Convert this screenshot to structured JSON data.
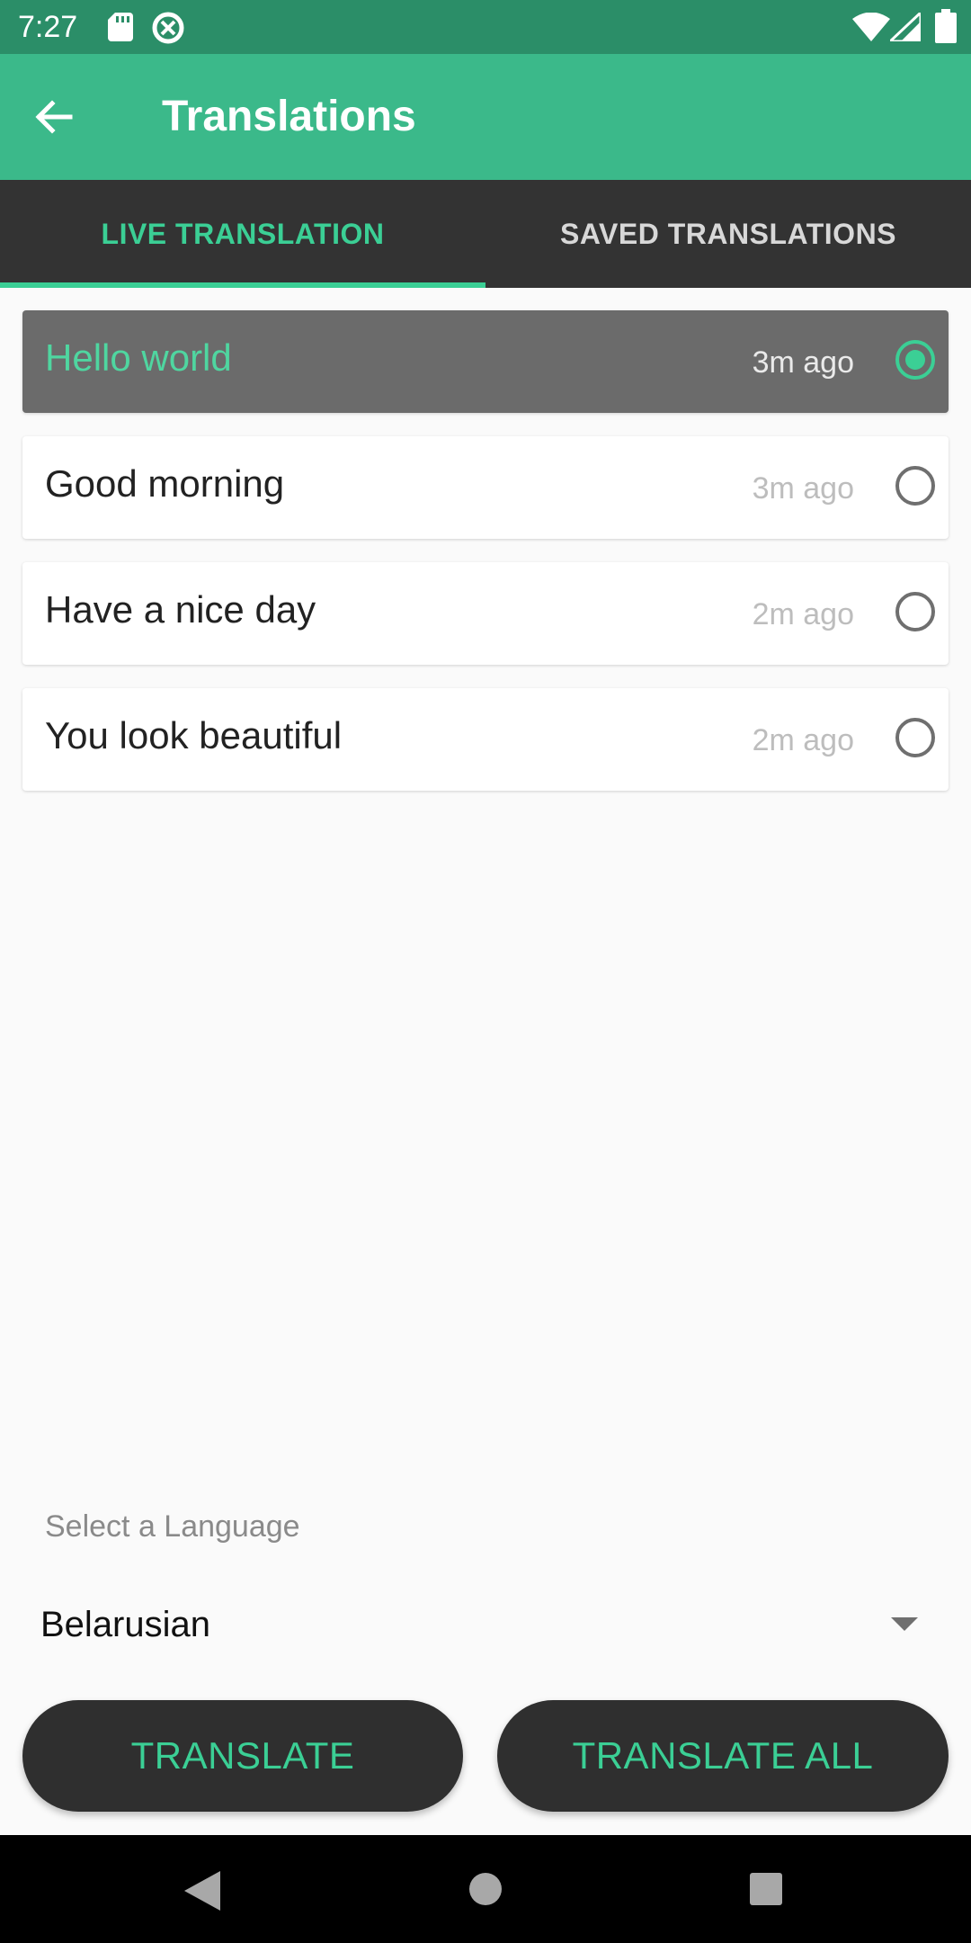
{
  "status_bar": {
    "time": "7:27",
    "icons": [
      "sd-card-icon",
      "data-saver-icon",
      "wifi-icon",
      "cell-signal-icon",
      "battery-icon"
    ]
  },
  "app_bar": {
    "title": "Translations",
    "back_icon": "arrow-left-icon",
    "color": "#3bb98a"
  },
  "tabs": [
    {
      "label": "LIVE TRANSLATION",
      "active": true
    },
    {
      "label": "SAVED TRANSLATIONS",
      "active": false
    }
  ],
  "translations": [
    {
      "text": "Hello world",
      "time": "3m ago",
      "selected": true
    },
    {
      "text": "Good morning",
      "time": "3m ago",
      "selected": false
    },
    {
      "text": "Have a nice day",
      "time": "2m ago",
      "selected": false
    },
    {
      "text": "You look beautiful",
      "time": "2m ago",
      "selected": false
    }
  ],
  "language": {
    "label": "Select a Language",
    "selected": "Belarusian"
  },
  "buttons": {
    "translate": "TRANSLATE",
    "translate_all": "TRANSLATE ALL"
  },
  "nav_bar": {
    "icons": [
      "back-triangle-icon",
      "home-circle-icon",
      "recents-square-icon"
    ]
  },
  "colors": {
    "accent": "#3bcf95",
    "status_bar": "#2b8e68",
    "tab_bar": "#333333",
    "selected_row": "#6b6b6b"
  }
}
